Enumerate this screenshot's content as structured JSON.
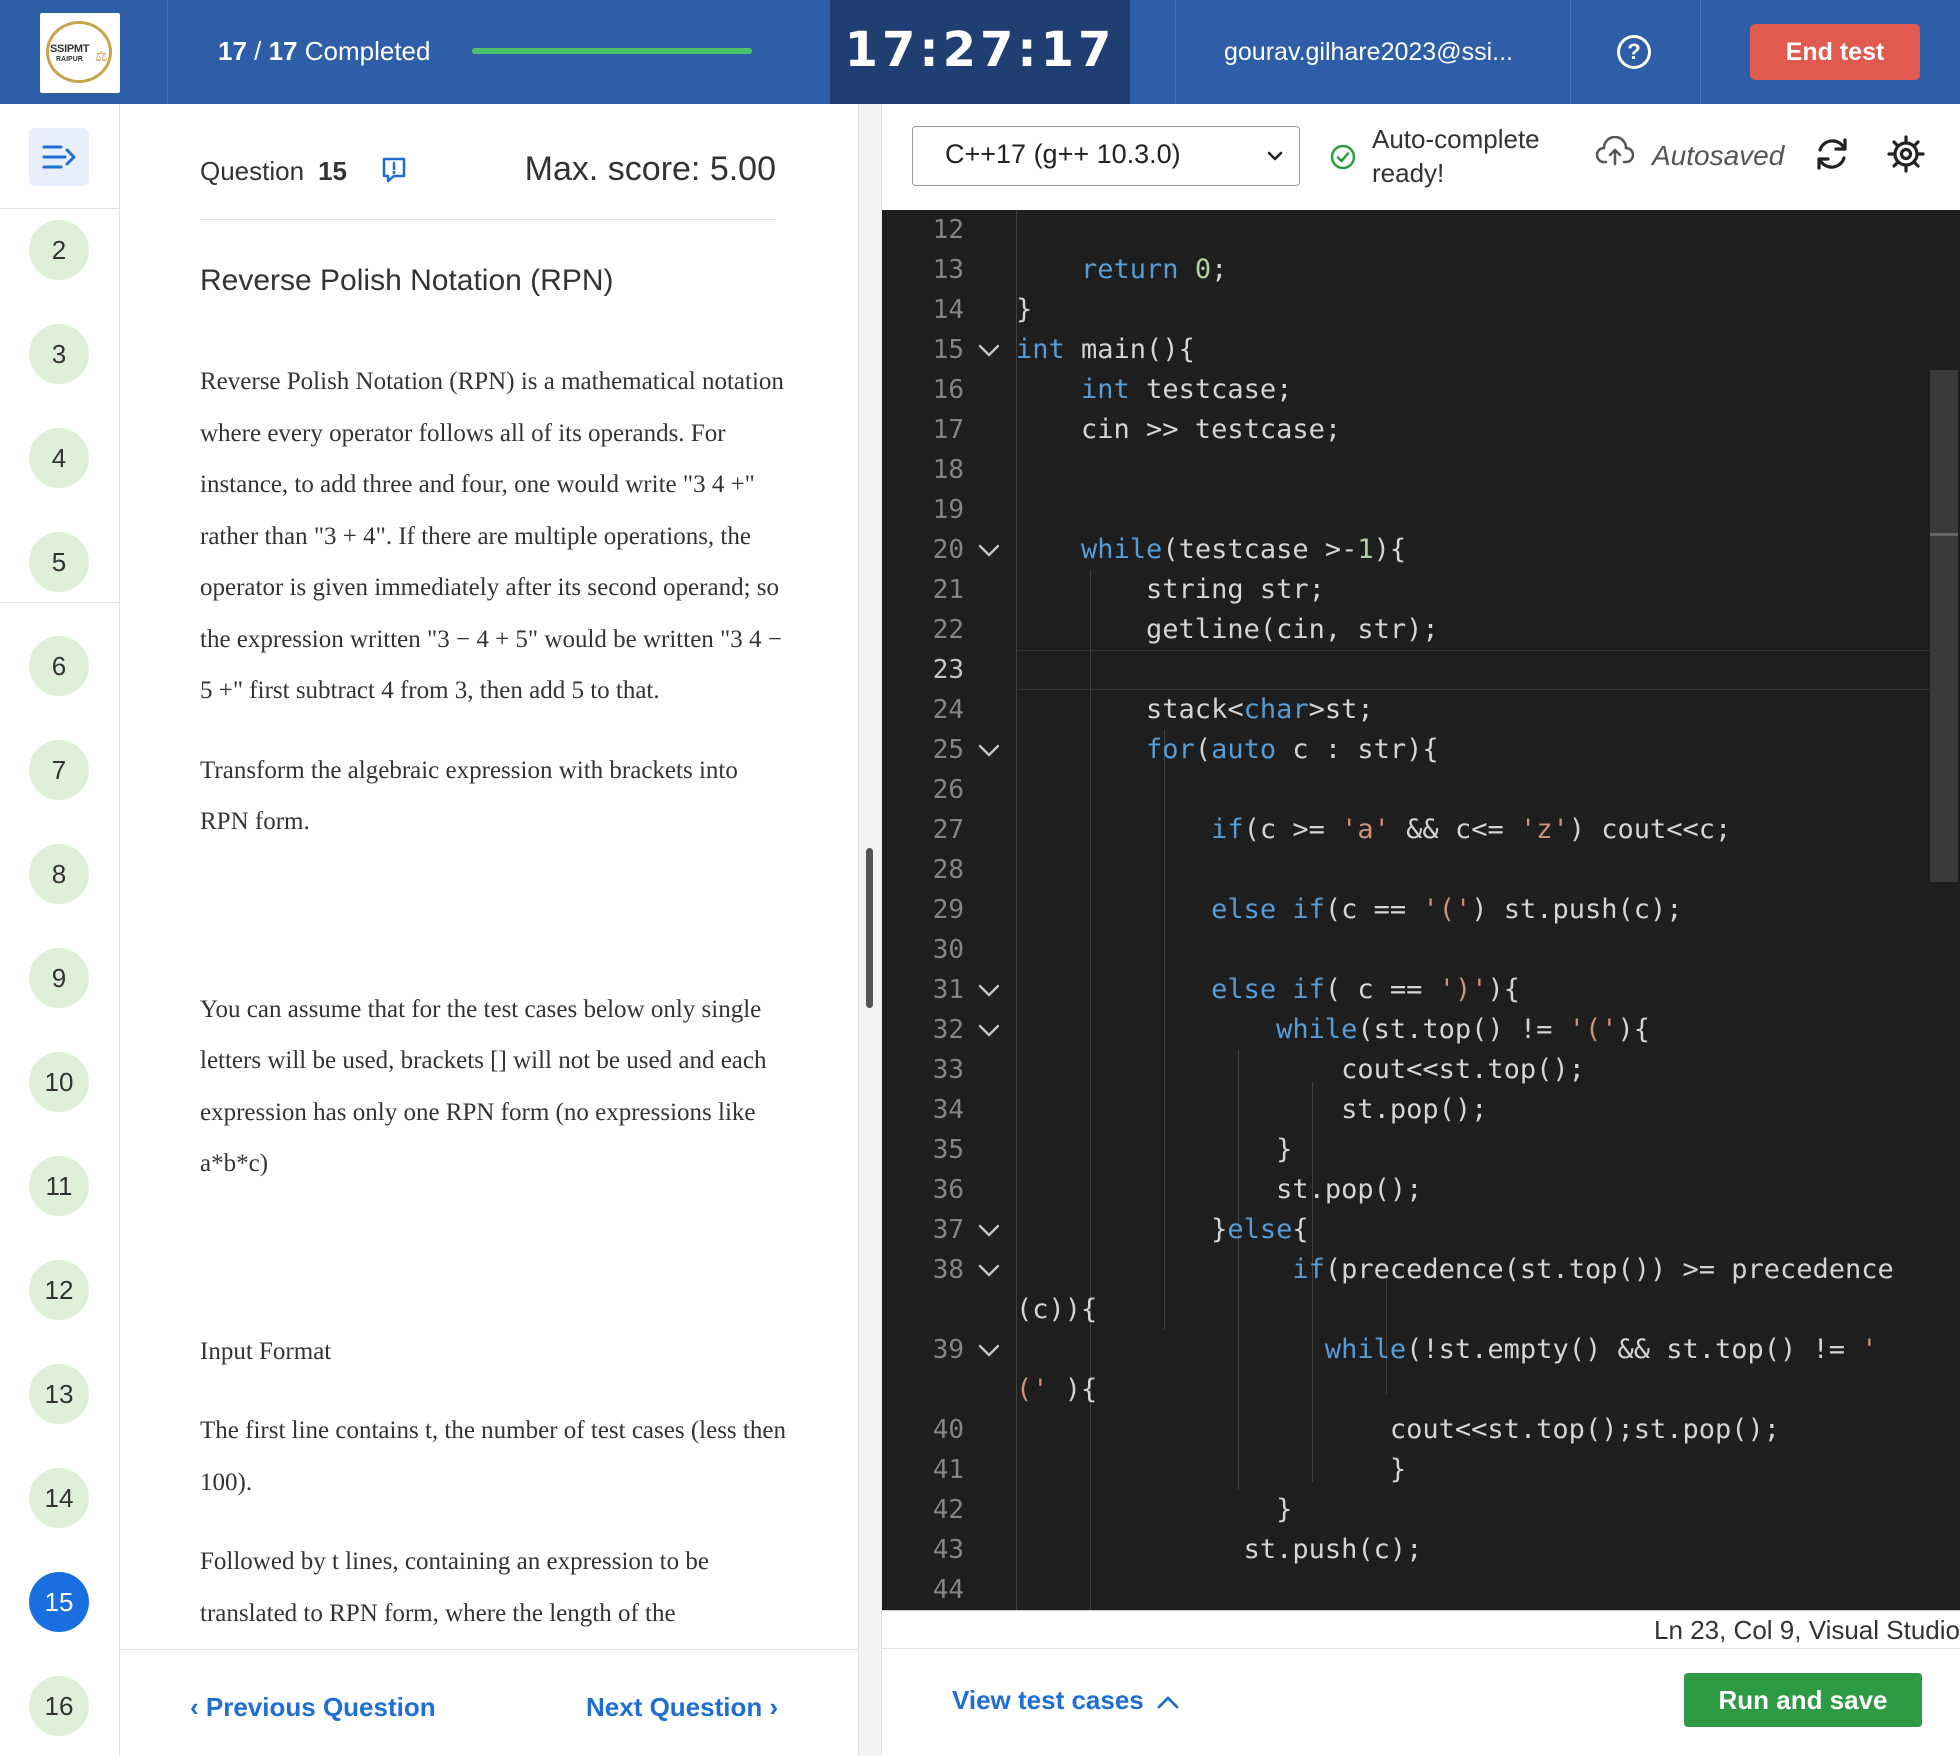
{
  "header": {
    "logo_line1": "SSIPMT",
    "logo_line2": "RAIPUR",
    "progress_done": "17",
    "progress_sep": " / ",
    "progress_total": "17",
    "progress_label": " Completed",
    "progress_fraction": 1.0,
    "timer": "17:27:17",
    "email": "gourav.gilhare2023@ssi...",
    "help_symbol": "?",
    "end_test_label": "End test",
    "colors": {
      "bar": "#2f5ea8",
      "timer_bg": "#1f3f73",
      "end_btn": "#e05a4f",
      "progress_fill": "#4cc36b"
    }
  },
  "sidebar": {
    "menu_icon": "collapse-menu-icon",
    "questions": [
      "2",
      "3",
      "4",
      "5",
      "6",
      "7",
      "8",
      "9",
      "10",
      "11",
      "12",
      "13",
      "14",
      "15",
      "16"
    ],
    "active_question": "15"
  },
  "question": {
    "label": "Question",
    "number": "15",
    "flag_icon": "flag-icon",
    "max_score": "Max. score: 5.00",
    "title": "Reverse Polish Notation (RPN)",
    "paragraphs": [
      "Reverse Polish Notation (RPN) is a mathematical notation where every operator follows all of its operands. For instance, to add three and four, one would write \"3 4 +\" rather than \"3 + 4\". If there are multiple operations, the operator is given immediately after its second operand; so the expression written \"3 − 4 + 5\" would be written \"3 4 − 5 +\" first subtract 4 from 3, then add 5 to that.",
      "Transform the algebraic expression with brackets into RPN form.",
      "You can assume that for the test cases below only single letters will be used, brackets [] will not be used and each expression has only one RPN form (no expressions like a*b*c)",
      "Input Format",
      "The first line contains t, the number of test cases (less then 100).",
      "Followed by t lines, containing an expression to be translated to RPN form, where the length of the"
    ],
    "prev_label": "Previous Question",
    "next_label": "Next Question"
  },
  "editor": {
    "language": "C++17 (g++ 10.3.0)",
    "autocomplete_line1": "Auto-complete",
    "autocomplete_line2": "ready!",
    "autosaved": "Autosaved",
    "status": "Ln 23, Col 9, Visual Studio",
    "view_tests_label": "View test cases",
    "run_label": "Run and save",
    "run_color": "#2e9b44",
    "code_lines": [
      {
        "n": "12",
        "fold": false,
        "tokens": []
      },
      {
        "n": "13",
        "fold": false,
        "tokens": [
          [
            "    ",
            ""
          ],
          [
            "return",
            "kw"
          ],
          [
            " ",
            ""
          ],
          [
            "0",
            "num"
          ],
          [
            ";",
            ""
          ]
        ]
      },
      {
        "n": "14",
        "fold": false,
        "tokens": [
          [
            "}",
            ""
          ]
        ]
      },
      {
        "n": "15",
        "fold": true,
        "tokens": [
          [
            "int",
            "kw"
          ],
          [
            " main(){",
            ""
          ]
        ]
      },
      {
        "n": "16",
        "fold": false,
        "tokens": [
          [
            "    ",
            ""
          ],
          [
            "int",
            "kw"
          ],
          [
            " testcase;",
            ""
          ]
        ]
      },
      {
        "n": "17",
        "fold": false,
        "tokens": [
          [
            "    cin >> testcase;",
            ""
          ]
        ]
      },
      {
        "n": "18",
        "fold": false,
        "tokens": []
      },
      {
        "n": "19",
        "fold": false,
        "tokens": []
      },
      {
        "n": "20",
        "fold": true,
        "tokens": [
          [
            "    ",
            ""
          ],
          [
            "while",
            "kw"
          ],
          [
            "(testcase >-",
            ""
          ],
          [
            "1",
            "num"
          ],
          [
            "){",
            ""
          ]
        ]
      },
      {
        "n": "21",
        "fold": false,
        "tokens": [
          [
            "        string str;",
            ""
          ]
        ]
      },
      {
        "n": "22",
        "fold": false,
        "tokens": [
          [
            "        getline(cin, str);",
            ""
          ]
        ]
      },
      {
        "n": "23",
        "fold": false,
        "tokens": [],
        "current": true
      },
      {
        "n": "24",
        "fold": false,
        "tokens": [
          [
            "        stack<",
            ""
          ],
          [
            "char",
            "kw"
          ],
          [
            ">st;",
            ""
          ]
        ]
      },
      {
        "n": "25",
        "fold": true,
        "tokens": [
          [
            "        ",
            ""
          ],
          [
            "for",
            "kw"
          ],
          [
            "(",
            ""
          ],
          [
            "auto",
            "kw"
          ],
          [
            " c : str){",
            ""
          ]
        ]
      },
      {
        "n": "26",
        "fold": false,
        "tokens": []
      },
      {
        "n": "27",
        "fold": false,
        "tokens": [
          [
            "            ",
            ""
          ],
          [
            "if",
            "kw"
          ],
          [
            "(c >= ",
            ""
          ],
          [
            "'a'",
            "str"
          ],
          [
            " && c<= ",
            ""
          ],
          [
            "'z'",
            "str"
          ],
          [
            ") cout<<c;",
            ""
          ]
        ]
      },
      {
        "n": "28",
        "fold": false,
        "tokens": []
      },
      {
        "n": "29",
        "fold": false,
        "tokens": [
          [
            "            ",
            ""
          ],
          [
            "else",
            "kw"
          ],
          [
            " ",
            ""
          ],
          [
            "if",
            "kw"
          ],
          [
            "(c == ",
            ""
          ],
          [
            "'('",
            "str"
          ],
          [
            ") st.push(c);",
            ""
          ]
        ]
      },
      {
        "n": "30",
        "fold": false,
        "tokens": []
      },
      {
        "n": "31",
        "fold": true,
        "tokens": [
          [
            "            ",
            ""
          ],
          [
            "else",
            "kw"
          ],
          [
            " ",
            ""
          ],
          [
            "if",
            "kw"
          ],
          [
            "( c == ",
            ""
          ],
          [
            "')'",
            "str"
          ],
          [
            "){",
            ""
          ]
        ]
      },
      {
        "n": "32",
        "fold": true,
        "tokens": [
          [
            "                ",
            ""
          ],
          [
            "while",
            "kw"
          ],
          [
            "(st.top() != ",
            ""
          ],
          [
            "'('",
            "str"
          ],
          [
            "){",
            ""
          ]
        ]
      },
      {
        "n": "33",
        "fold": false,
        "tokens": [
          [
            "                    cout<<st.top();",
            ""
          ]
        ]
      },
      {
        "n": "34",
        "fold": false,
        "tokens": [
          [
            "                    st.pop();",
            ""
          ]
        ]
      },
      {
        "n": "35",
        "fold": false,
        "tokens": [
          [
            "                }",
            ""
          ]
        ]
      },
      {
        "n": "36",
        "fold": false,
        "tokens": [
          [
            "                st.pop();",
            ""
          ]
        ]
      },
      {
        "n": "37",
        "fold": true,
        "tokens": [
          [
            "            }",
            ""
          ],
          [
            "else",
            "kw"
          ],
          [
            "{",
            ""
          ]
        ]
      },
      {
        "n": "38",
        "fold": true,
        "tokens": [
          [
            "                 ",
            ""
          ],
          [
            "if",
            "kw"
          ],
          [
            "(precedence(st.top()) >= precedence",
            ""
          ]
        ]
      },
      {
        "n": "",
        "fold": false,
        "tokens": [
          [
            "(c)){",
            ""
          ]
        ]
      },
      {
        "n": "39",
        "fold": true,
        "tokens": [
          [
            "                   ",
            ""
          ],
          [
            "while",
            "kw"
          ],
          [
            "(!st.empty() && st.top() != ",
            ""
          ],
          [
            "'",
            "str"
          ]
        ]
      },
      {
        "n": "",
        "fold": false,
        "tokens": [
          [
            "(' ",
            "str"
          ],
          [
            "){",
            ""
          ]
        ]
      },
      {
        "n": "40",
        "fold": false,
        "tokens": [
          [
            "                       cout<<st.top();st.pop();",
            ""
          ]
        ]
      },
      {
        "n": "41",
        "fold": false,
        "tokens": [
          [
            "                       }",
            ""
          ]
        ]
      },
      {
        "n": "42",
        "fold": false,
        "tokens": [
          [
            "                }",
            ""
          ]
        ]
      },
      {
        "n": "43",
        "fold": false,
        "tokens": [
          [
            "              st.push(c);",
            ""
          ]
        ]
      },
      {
        "n": "44",
        "fold": false,
        "tokens": []
      }
    ]
  }
}
